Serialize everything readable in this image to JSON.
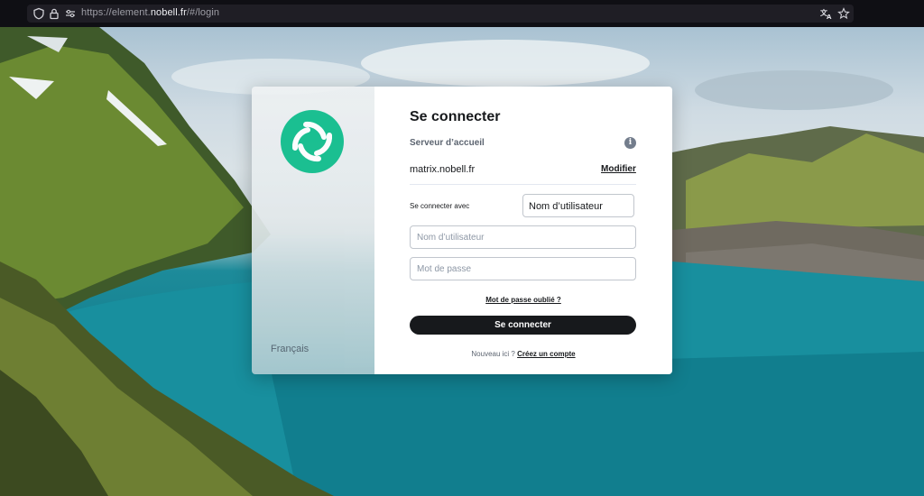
{
  "browser": {
    "url_prefix": "https://element.",
    "url_host": "nobell.fr",
    "url_suffix": "/#/login"
  },
  "sidebar": {
    "language": "Français"
  },
  "login": {
    "title": "Se connecter",
    "homeserver_label": "Serveur d’accueil",
    "homeserver_value": "matrix.nobell.fr",
    "modify_label": "Modifier",
    "login_with_label": "Se connecter avec",
    "login_with_selected": "Nom d’utilisateur",
    "username_placeholder": "Nom d’utilisateur",
    "password_placeholder": "Mot de passe",
    "forgot_password": "Mot de passe oublié ?",
    "submit_label": "Se connecter",
    "signup_prompt": "Nouveau ici ?",
    "signup_link": "Créez un compte"
  },
  "colors": {
    "brand": "#0dbd8b",
    "button": "#17191c"
  },
  "icons": {
    "shield": "shield-icon",
    "lock": "lock-icon",
    "permissions": "permissions-icon",
    "translate": "translate-icon",
    "bookmark": "star-icon",
    "info": "info-icon",
    "logo": "element-logo-icon"
  }
}
